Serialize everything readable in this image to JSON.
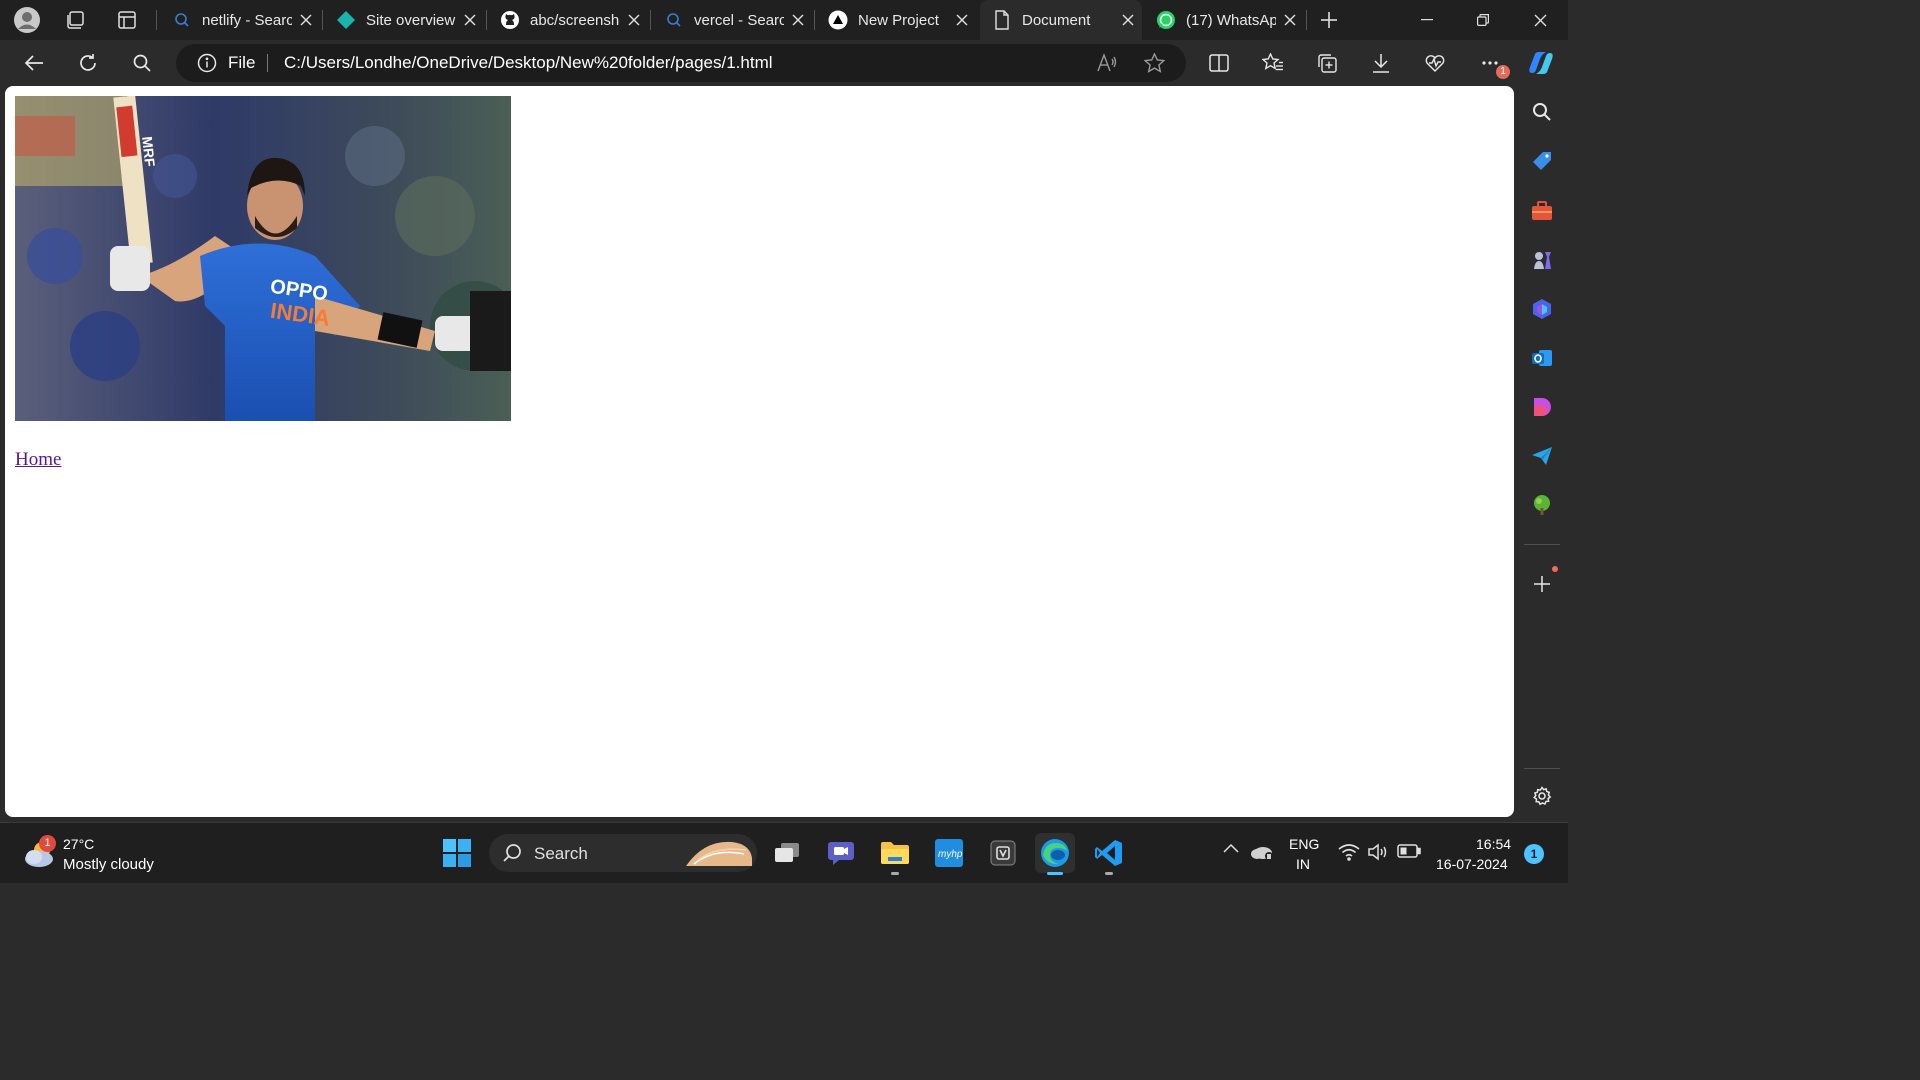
{
  "browser": {
    "tabs": [
      {
        "title": "netlify - Search",
        "icon": "search-icon",
        "active": false
      },
      {
        "title": "Site overview",
        "icon": "netlify-icon",
        "active": false
      },
      {
        "title": "abc/screenshots",
        "icon": "github-icon",
        "active": false
      },
      {
        "title": "vercel - Search",
        "icon": "search-icon",
        "active": false
      },
      {
        "title": "New Project",
        "icon": "vercel-icon",
        "active": false
      },
      {
        "title": "Document",
        "icon": "document-icon",
        "active": true
      },
      {
        "title": "(17) WhatsApp",
        "icon": "whatsapp-icon",
        "active": false
      }
    ],
    "address": {
      "scheme_label": "File",
      "url": "C:/Users/Londhe/OneDrive/Desktop/New%20folder/pages/1.html"
    },
    "extensions_badge": "1"
  },
  "page": {
    "link_text": "Home",
    "image_texts": [
      "MRF",
      "OPPO",
      "INDIA"
    ]
  },
  "taskbar": {
    "weather": {
      "temp": "27°C",
      "condition": "Mostly cloudy",
      "badge": "1"
    },
    "search_label": "Search",
    "lang_top": "ENG",
    "lang_bottom": "IN",
    "time": "16:54",
    "date": "16-07-2024",
    "notification_count": "1"
  },
  "colors": {
    "tab_bar": "#202020",
    "toolbar": "#2b2b2b",
    "taskbar": "#1f1f1f",
    "link_visited": "#551a8b",
    "accent": "#4cc2ff"
  }
}
